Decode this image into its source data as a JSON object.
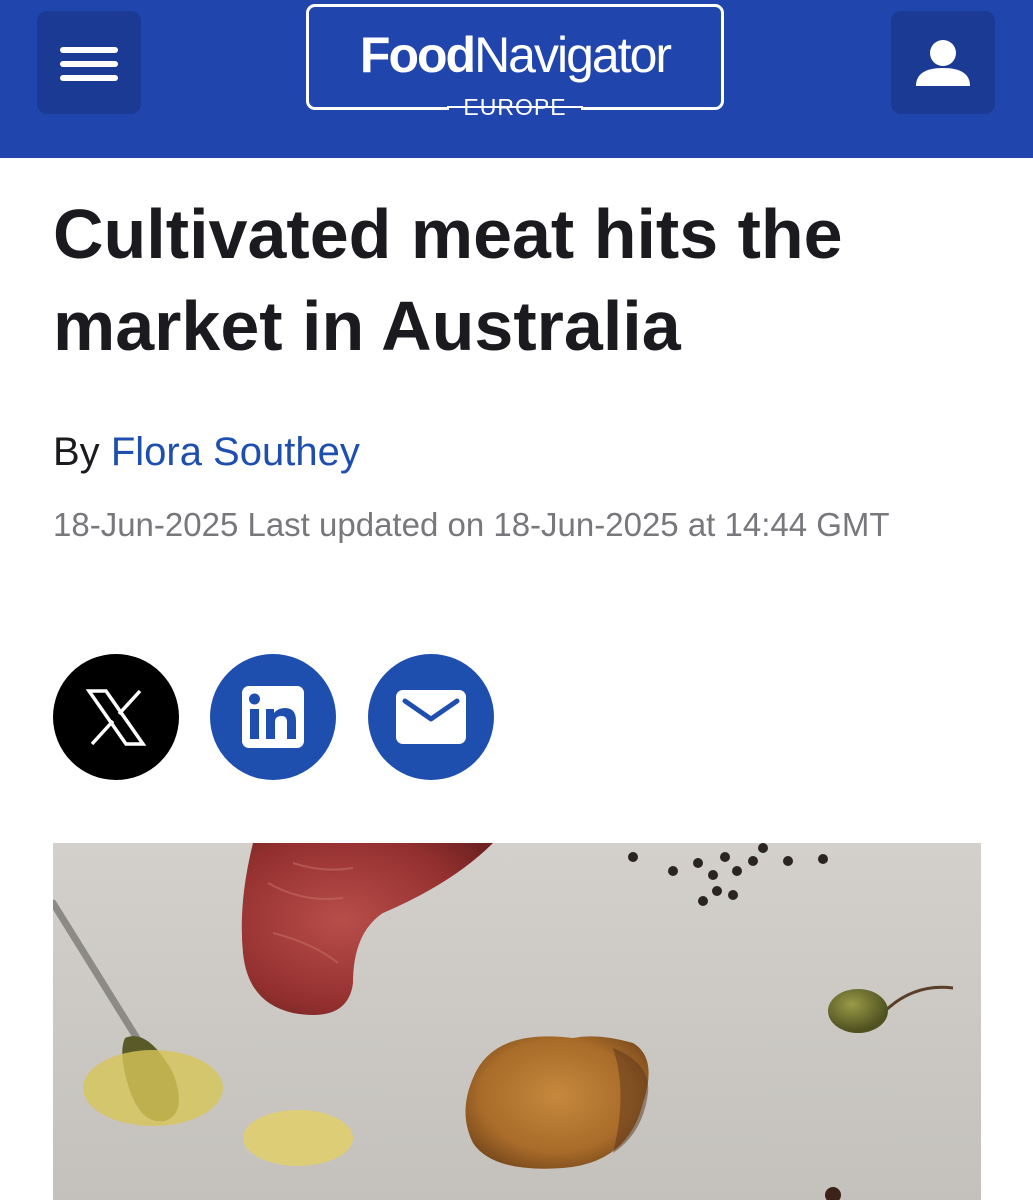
{
  "header": {
    "menu_icon": "hamburger-menu-icon",
    "logo": {
      "food": "Food",
      "navigator": "Navigator",
      "region": "EUROPE"
    },
    "account_icon": "user-icon",
    "colors": {
      "bar": "#2046ae",
      "button": "#1a3a93"
    }
  },
  "article": {
    "title": "Cultivated meat hits the market in Australia",
    "by_label": "By",
    "author": "Flora Southey",
    "dateline": "18-Jun-2025 Last updated on 18-Jun-2025 at 14:44 GMT"
  },
  "share": {
    "x_icon": "x-logo-icon",
    "linkedin_icon": "linkedin-icon",
    "email_icon": "email-icon"
  },
  "colors": {
    "title": "#1b1b1f",
    "author_link": "#1f4fae",
    "dateline": "#77777c"
  }
}
